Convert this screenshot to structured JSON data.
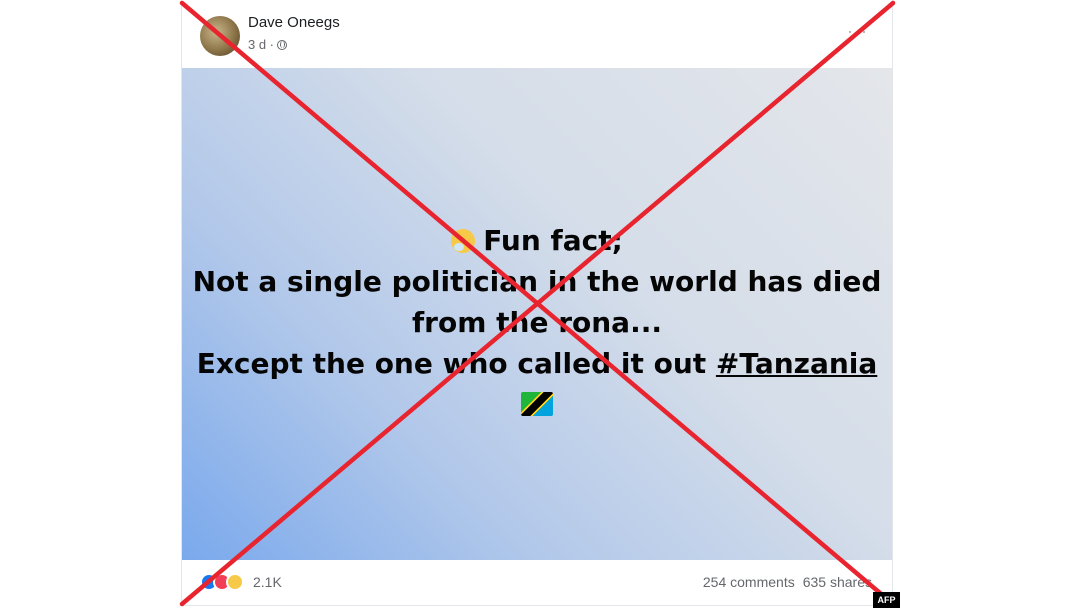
{
  "post": {
    "author": "Dave Oneegs",
    "timestamp": "3 d ·",
    "more_icon": "···",
    "text": {
      "line1": "Fun fact;",
      "line2": "Not a single politician in the world has died",
      "line3": "from the rona...",
      "line4_prefix": "Except the one who called it out ",
      "hashtag": "#Tanzania"
    },
    "icons": {
      "emoji": "thinking-face-emoji-icon",
      "flag": "tanzania-flag-icon",
      "privacy": "globe-icon"
    },
    "reactions": {
      "icons": [
        "like-icon",
        "love-icon",
        "sad-icon"
      ],
      "count": "2.1K"
    },
    "comments": "254 comments",
    "shares": "635 shares",
    "background_gradient": [
      "#7aa9ec",
      "#e4e6ea"
    ]
  },
  "overlay": {
    "cross_color": "#e8242f",
    "watermark": "AFP"
  }
}
